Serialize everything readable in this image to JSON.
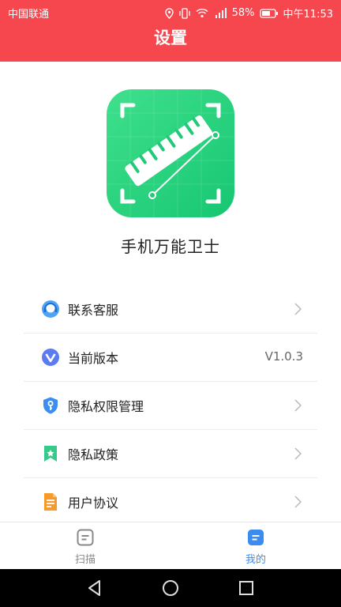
{
  "status_bar": {
    "carrier": "中国联通",
    "battery": "58%",
    "time": "中午11:53"
  },
  "header": {
    "title": "设置"
  },
  "app": {
    "name": "手机万能卫士"
  },
  "menu": {
    "items": [
      {
        "label": "联系客服",
        "icon": "customer-service-icon"
      },
      {
        "label": "当前版本",
        "icon": "version-icon",
        "value": "V1.0.3"
      },
      {
        "label": "隐私权限管理",
        "icon": "shield-key-icon"
      },
      {
        "label": "隐私政策",
        "icon": "bookmark-star-icon"
      },
      {
        "label": "用户协议",
        "icon": "document-icon"
      }
    ]
  },
  "tabbar": {
    "tabs": [
      {
        "label": "扫描",
        "icon": "scan-icon"
      },
      {
        "label": "我的",
        "icon": "mine-icon"
      }
    ],
    "active": "我的",
    "active_color": "#3b8cf0",
    "inactive_color": "#888888"
  },
  "colors": {
    "header": "#f5474d",
    "logo": "#22c979"
  }
}
